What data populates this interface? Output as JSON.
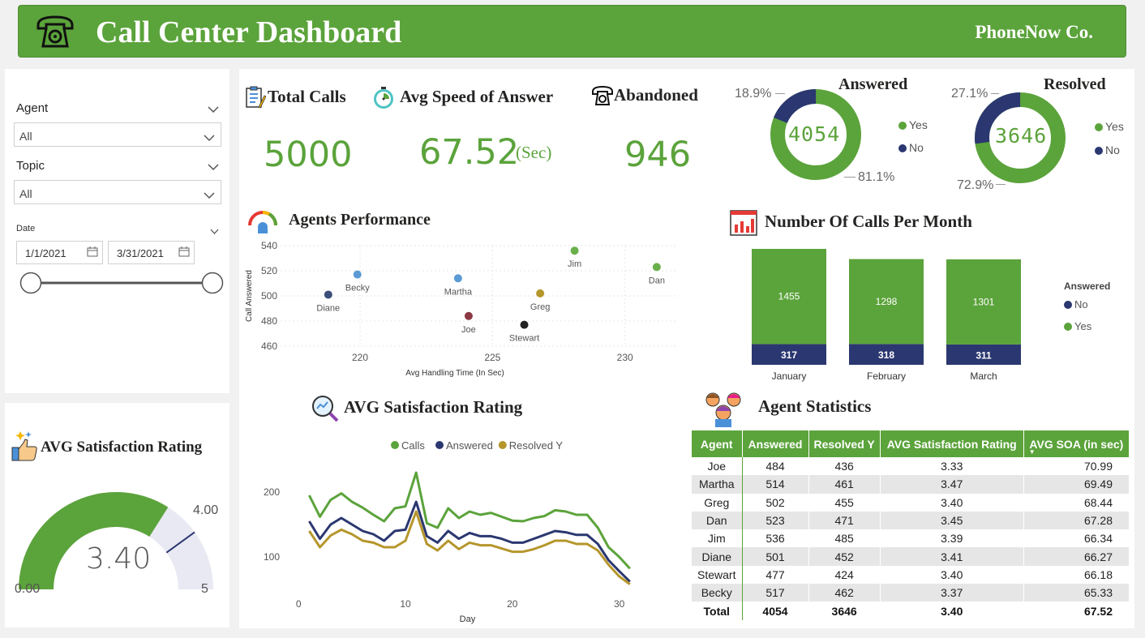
{
  "header": {
    "title": "Call Center Dashboard",
    "company": "PhoneNow Co."
  },
  "filters": {
    "agent_label": "Agent",
    "agent_value": "All",
    "topic_label": "Topic",
    "topic_value": "All",
    "date_label": "Date",
    "date_start": "1/1/2021",
    "date_end": "3/31/2021",
    "range_start_fraction": 0,
    "range_end_fraction": 1
  },
  "kpis": {
    "total_calls_label": "Total Calls",
    "total_calls_value": "5000",
    "avg_speed_label": "Avg Speed of Answer",
    "avg_speed_value": "67.52",
    "avg_speed_unit": "(Sec)",
    "abandoned_label": "Abandoned",
    "abandoned_value": "946"
  },
  "answered_donut": {
    "title": "Answered",
    "center": "4054",
    "no_pct": "18.9%",
    "yes_pct": "81.1%",
    "no_fraction": 0.189,
    "legend_yes": "Yes",
    "legend_no": "No"
  },
  "resolved_donut": {
    "title": "Resolved",
    "center": "3646",
    "no_pct": "27.1%",
    "yes_pct": "72.9%",
    "no_fraction": 0.271,
    "legend_yes": "Yes",
    "legend_no": "No"
  },
  "colors": {
    "green": "#5ba33b",
    "navy": "#2b3770",
    "gold": "#b5962b",
    "gauge_bg": "#e9e9f4"
  },
  "satisfaction_gauge": {
    "title": "AVG Satisfaction Rating",
    "value": 3.4,
    "value_label": "3.40",
    "min": 0,
    "max": 5,
    "min_label": "0.00",
    "max_label": "5",
    "target": 4,
    "target_label": "4.00"
  },
  "agents_performance": {
    "title": "Agents Performance",
    "chart_data": {
      "type": "scatter",
      "xlabel": "Avg Handling Time (In Sec)",
      "ylabel": "Call Answered",
      "xlim": [
        217,
        232
      ],
      "ylim": [
        460,
        540
      ],
      "xticks": [
        "220",
        "225",
        "230"
      ],
      "xtick_values": [
        220,
        225,
        230
      ],
      "yticks": [
        "460",
        "480",
        "500",
        "520",
        "540"
      ],
      "ytick_values": [
        460,
        480,
        500,
        520,
        540
      ],
      "points": [
        {
          "name": "Jim",
          "x": 228.1,
          "y": 536,
          "color": "#6ab04c"
        },
        {
          "name": "Dan",
          "x": 231.2,
          "y": 523,
          "color": "#6ab04c"
        },
        {
          "name": "Becky",
          "x": 219.9,
          "y": 517,
          "color": "#5b9bd5"
        },
        {
          "name": "Martha",
          "x": 223.7,
          "y": 514,
          "color": "#5b9bd5"
        },
        {
          "name": "Diane",
          "x": 218.8,
          "y": 501,
          "color": "#3c4e7a"
        },
        {
          "name": "Greg",
          "x": 226.8,
          "y": 502,
          "color": "#b5962b"
        },
        {
          "name": "Joe",
          "x": 224.1,
          "y": 484,
          "color": "#8b3a44"
        },
        {
          "name": "Stewart",
          "x": 226.2,
          "y": 477,
          "color": "#222222"
        }
      ]
    }
  },
  "calls_per_month": {
    "title": "Number Of Calls Per Month",
    "legend_title": "Answered",
    "legend_no": "No",
    "legend_yes": "Yes",
    "chart_data": {
      "type": "bar",
      "stacked": true,
      "categories": [
        "January",
        "February",
        "March"
      ],
      "series": [
        {
          "name": "No",
          "values": [
            317,
            318,
            311
          ],
          "labels": [
            "317",
            "318",
            "311"
          ]
        },
        {
          "name": "Yes",
          "values": [
            1455,
            1298,
            1301
          ],
          "labels": [
            "1455",
            "1298",
            "1301"
          ]
        }
      ]
    }
  },
  "satisfaction_line": {
    "title": "AVG Satisfaction Rating",
    "chart_data": {
      "type": "line",
      "xlabel": "Day",
      "xlim": [
        -1,
        32
      ],
      "ylim": [
        40,
        240
      ],
      "xticks": [
        "0",
        "10",
        "20",
        "30"
      ],
      "xtick_values": [
        0,
        10,
        20,
        30
      ],
      "yticks": [
        "100",
        "200"
      ],
      "ytick_values": [
        100,
        200
      ],
      "x": [
        1,
        2,
        3,
        4,
        5,
        6,
        7,
        8,
        9,
        10,
        11,
        12,
        13,
        14,
        15,
        16,
        17,
        18,
        19,
        20,
        21,
        22,
        23,
        24,
        25,
        26,
        27,
        28,
        29,
        30,
        31
      ],
      "series": [
        {
          "name": "Calls",
          "values": [
            195,
            162,
            188,
            198,
            185,
            176,
            165,
            155,
            175,
            178,
            230,
            152,
            145,
            175,
            160,
            170,
            165,
            168,
            162,
            156,
            155,
            160,
            163,
            172,
            170,
            165,
            165,
            145,
            115,
            100,
            82
          ]
        },
        {
          "name": "Answered",
          "values": [
            155,
            128,
            150,
            160,
            150,
            140,
            135,
            125,
            140,
            142,
            185,
            132,
            122,
            140,
            128,
            137,
            132,
            132,
            128,
            122,
            122,
            128,
            134,
            140,
            138,
            134,
            134,
            120,
            95,
            78,
            62
          ]
        },
        {
          "name": "Resolved Y",
          "values": [
            140,
            115,
            133,
            142,
            135,
            125,
            122,
            115,
            115,
            125,
            170,
            120,
            110,
            125,
            112,
            122,
            118,
            118,
            113,
            108,
            108,
            112,
            118,
            125,
            125,
            120,
            120,
            110,
            88,
            70,
            58
          ]
        }
      ]
    }
  },
  "agent_stats": {
    "title": "Agent Statistics",
    "columns": [
      "Agent",
      "Answered",
      "Resolved Y",
      "AVG Satisfaction Rating",
      "AVG SOA (in sec)"
    ],
    "rows": [
      [
        "Joe",
        "484",
        "436",
        "3.33",
        "70.99"
      ],
      [
        "Martha",
        "514",
        "461",
        "3.47",
        "69.49"
      ],
      [
        "Greg",
        "502",
        "455",
        "3.40",
        "68.44"
      ],
      [
        "Dan",
        "523",
        "471",
        "3.45",
        "67.28"
      ],
      [
        "Jim",
        "536",
        "485",
        "3.39",
        "66.34"
      ],
      [
        "Diane",
        "501",
        "452",
        "3.41",
        "66.27"
      ],
      [
        "Stewart",
        "477",
        "424",
        "3.40",
        "66.18"
      ],
      [
        "Becky",
        "517",
        "462",
        "3.37",
        "65.33"
      ]
    ],
    "total": [
      "Total",
      "4054",
      "3646",
      "3.40",
      "67.52"
    ]
  }
}
